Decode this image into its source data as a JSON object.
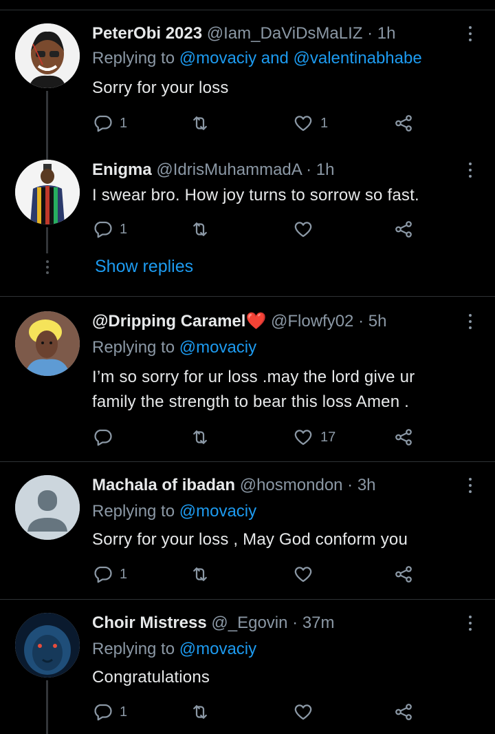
{
  "tweets": [
    {
      "name": "PeterObi 2023",
      "handle": "@Iam_DaViDsMaLIZ · 1h",
      "replying_prefix": "Replying to ",
      "replying_to": "@movaciy and @valentinabhabe",
      "text": "Sorry for your loss",
      "reply_count": "1",
      "retweet_count": "",
      "like_count": "1"
    },
    {
      "name": "Enigma",
      "handle": "@IdrisMuhammadA · 1h",
      "text": "I swear bro. How joy turns to sorrow so fast.",
      "reply_count": "1",
      "retweet_count": "",
      "like_count": ""
    },
    {
      "name": "@Dripping Caramel❤️",
      "handle": "@Flowfy02 · 5h",
      "replying_prefix": "Replying to ",
      "replying_to": "@movaciy",
      "text_line1": "I’m so sorry for ur loss .may the lord give ur",
      "text_line2": "family the strength to bear this loss Amen .",
      "reply_count": "",
      "retweet_count": "",
      "like_count": "17"
    },
    {
      "name": "Machala of ibadan",
      "handle": "@hosmondon · 3h",
      "replying_prefix": "Replying to ",
      "replying_to": "@movaciy",
      "text": "Sorry for your loss , May God conform you",
      "reply_count": "1",
      "retweet_count": "",
      "like_count": ""
    },
    {
      "name": "Choir Mistress",
      "handle": "@_Egovin · 37m",
      "replying_prefix": "Replying to ",
      "replying_to": "@movaciy",
      "text": "Congratulations",
      "reply_count": "1",
      "retweet_count": "",
      "like_count": ""
    }
  ],
  "show_replies_label": "Show replies",
  "colors": {
    "background": "#000000",
    "text": "#e7e9ea",
    "secondary": "#8b98a5",
    "link": "#1d9bf0",
    "divider": "#2f3336"
  },
  "icons": [
    "reply-icon",
    "retweet-icon",
    "like-icon",
    "share-icon",
    "more-icon"
  ]
}
